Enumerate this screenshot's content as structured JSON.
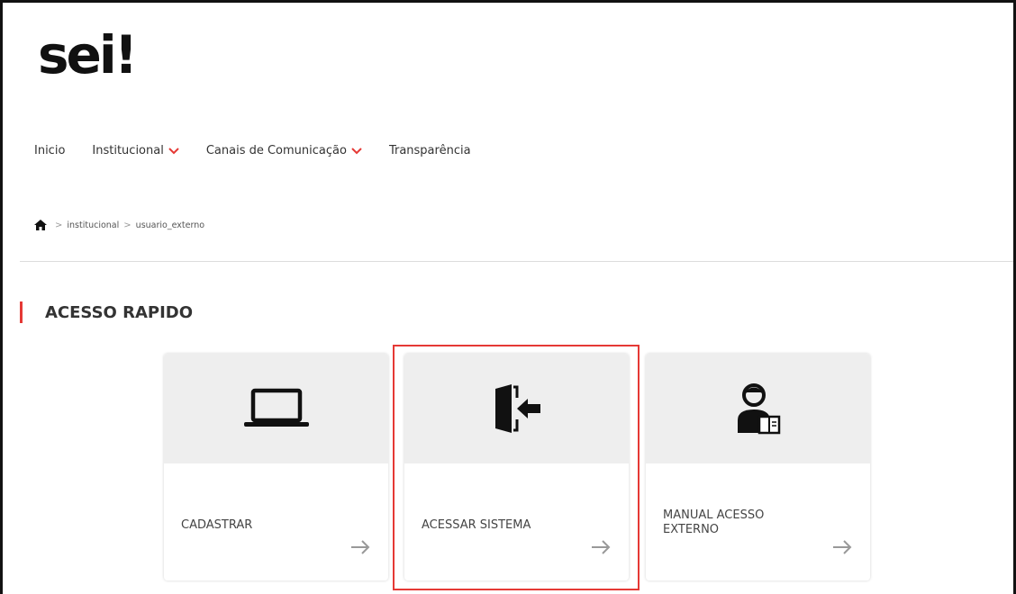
{
  "brand": {
    "logo_text": "sei!",
    "accent_color": "#e53935"
  },
  "nav": {
    "items": [
      {
        "label": "Inicio",
        "has_dropdown": false
      },
      {
        "label": "Institucional",
        "has_dropdown": true
      },
      {
        "label": "Canais de Comunicação",
        "has_dropdown": true
      },
      {
        "label": "Transparência",
        "has_dropdown": false
      }
    ]
  },
  "breadcrumb": {
    "home_icon": "home-icon",
    "items": [
      "institucional",
      "usuario_externo"
    ]
  },
  "section": {
    "title": "ACESSO RAPIDO"
  },
  "cards": [
    {
      "label": "CADASTRAR",
      "icon": "laptop-icon"
    },
    {
      "label": "ACESSAR SISTEMA",
      "icon": "door-enter-icon",
      "highlighted": true
    },
    {
      "label": "MANUAL ACESSO EXTERNO",
      "icon": "user-manual-icon"
    }
  ]
}
